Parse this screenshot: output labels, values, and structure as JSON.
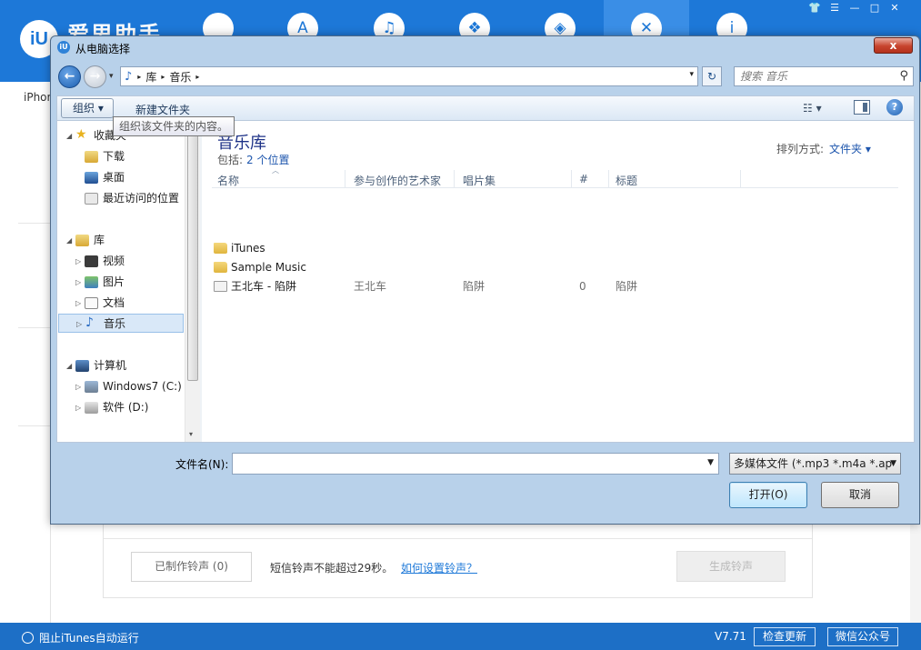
{
  "app": {
    "brand": "爱思助手",
    "logo_text": "iU",
    "device_label": "iPhor",
    "window_controls": [
      "👕",
      "☰",
      "—",
      "□",
      "✕"
    ],
    "nav_icons": [
      "apple-icon",
      "appstore-icon",
      "bell-icon",
      "gift-icon",
      "box-icon",
      "tools-icon",
      "info-icon"
    ],
    "panel": {
      "made_ringtones_button": "已制作铃声 (0)",
      "sms_hint": "短信铃声不能超过29秒。",
      "howto_link": "如何设置铃声？",
      "generate_button": "生成铃声"
    },
    "status_bar": {
      "block_itunes": "阻止iTunes自动运行",
      "version": "V7.71",
      "check_update": "检查更新",
      "wechat": "微信公众号"
    }
  },
  "dialog": {
    "title": "从电脑选择",
    "close_glyph": "x",
    "address": {
      "crumbs": [
        "库",
        "音乐"
      ],
      "separator": "▸",
      "dropdown": "▾",
      "refresh_glyph": "↻"
    },
    "search": {
      "placeholder": "搜索 音乐"
    },
    "toolbar": {
      "organize": "组织 ▾",
      "new_folder": "新建文件夹",
      "view": "☷ ▾",
      "help": "?"
    },
    "tooltip": "组织该文件夹的内容。",
    "nav_pane": {
      "favorites": "收藏夹",
      "downloads": "下载",
      "desktop": "桌面",
      "recent": "最近访问的位置",
      "libraries": "库",
      "videos": "视频",
      "pictures": "图片",
      "documents": "文档",
      "music": "音乐",
      "computer": "计算机",
      "drive_c": "Windows7 (C:)",
      "drive_d": "软件 (D:)"
    },
    "content": {
      "library_title": "音乐库",
      "includes_label": "包括:",
      "includes_link": "2 个位置",
      "arrange_label": "排列方式:",
      "arrange_value": "文件夹 ▾",
      "columns": [
        "名称",
        "参与创作的艺术家",
        "唱片集",
        "#",
        "标题"
      ],
      "files": [
        {
          "name": "iTunes",
          "type": "folder",
          "artist": "",
          "album": "",
          "track": "",
          "title": ""
        },
        {
          "name": "Sample Music",
          "type": "folder",
          "artist": "",
          "album": "",
          "track": "",
          "title": ""
        },
        {
          "name": "王北车 - 陷阱",
          "type": "song",
          "artist": "王北车",
          "album": "陷阱",
          "track": "0",
          "title": "陷阱"
        }
      ]
    },
    "filename_label": "文件名(N):",
    "filename_value": "",
    "filetype_value": "多媒体文件 (*.mp3 *.m4a *.ap",
    "open_button": "打开(O)",
    "cancel_button": "取消"
  }
}
